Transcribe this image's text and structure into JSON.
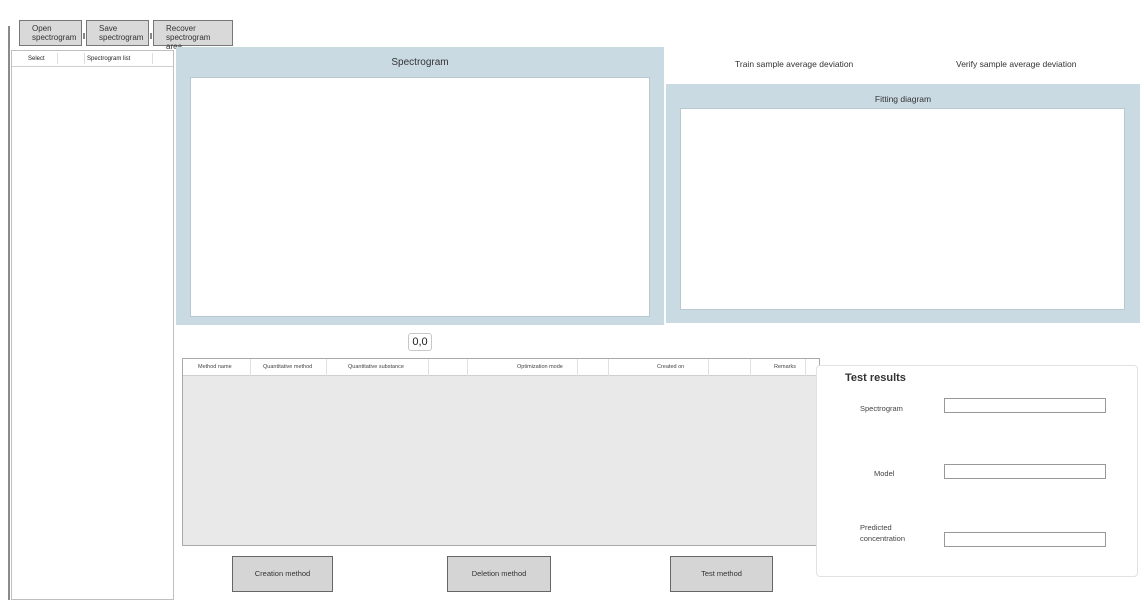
{
  "toolbar": {
    "open_label": "Open spectrogram",
    "save_label": "Save spectrogram",
    "recover_label": "Recover spectrogram area"
  },
  "spectrogram_list": {
    "columns": [
      "Select",
      "Spectrogram list"
    ]
  },
  "spectrogram_panel": {
    "title": "Spectrogram"
  },
  "deviation": {
    "train_label": "Train sample average deviation",
    "verify_label": "Verify sample average deviation"
  },
  "fitting_panel": {
    "title": "Fitting diagram"
  },
  "coordinate_readout": "0,0",
  "method_table": {
    "columns": [
      "Method name",
      "Quantitative method",
      "Quantitative substance",
      "Optimization mode",
      "Created on",
      "Remarks"
    ],
    "rows": []
  },
  "actions": {
    "create_label": "Creation method",
    "delete_label": "Deletion method",
    "test_label": "Test method"
  },
  "test_results": {
    "title": "Test results",
    "spectrogram_label": "Spectrogram",
    "spectrogram_value": "",
    "model_label": "Model",
    "model_value": "",
    "predicted_label": "Predicted concentration",
    "predicted_value": ""
  },
  "colors": {
    "panel_bg": "#c9dae3",
    "button_bg": "#d5d5d5",
    "table_bg": "#e9e9e9"
  }
}
